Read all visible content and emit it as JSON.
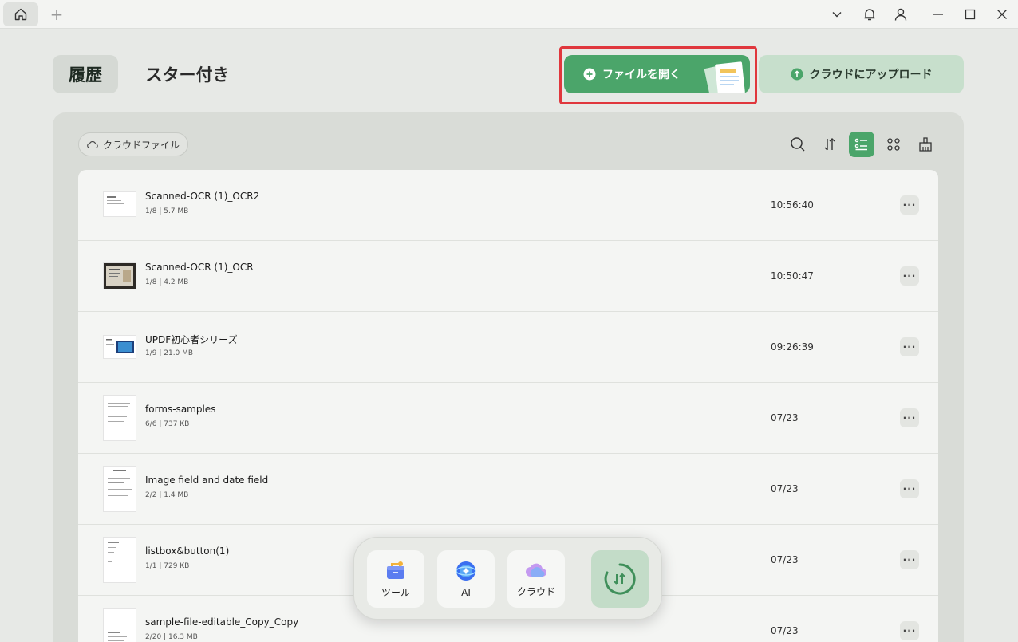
{
  "titlebar": {
    "add_tab": "+"
  },
  "header": {
    "tab_history": "履歴",
    "tab_starred": "スター付き",
    "open_file_label": "ファイルを開く",
    "upload_cloud_label": "クラウドにアップロード"
  },
  "toolbar": {
    "cloud_files_label": "クラウドファイル"
  },
  "files": [
    {
      "name": "Scanned-OCR (1)_OCR2",
      "meta": "1/8 | 5.7 MB",
      "time": "10:56:40"
    },
    {
      "name": "Scanned-OCR (1)_OCR",
      "meta": "1/8 | 4.2 MB",
      "time": "10:50:47"
    },
    {
      "name": "UPDF初心者シリーズ",
      "meta": "1/9 | 21.0 MB",
      "time": "09:26:39"
    },
    {
      "name": "forms-samples",
      "meta": "6/6 | 737 KB",
      "time": "07/23"
    },
    {
      "name": "Image field and date field",
      "meta": "2/2 | 1.4 MB",
      "time": "07/23"
    },
    {
      "name": "listbox&button(1)",
      "meta": "1/1 | 729 KB",
      "time": "07/23"
    },
    {
      "name": "sample-file-editable_Copy_Copy",
      "meta": "2/20 | 16.3 MB",
      "time": "07/23"
    }
  ],
  "row_more": "···",
  "dock": {
    "tools_label": "ツール",
    "ai_label": "AI",
    "cloud_label": "クラウド"
  },
  "colors": {
    "accent": "#4ba56a",
    "highlight": "#e0373d"
  }
}
